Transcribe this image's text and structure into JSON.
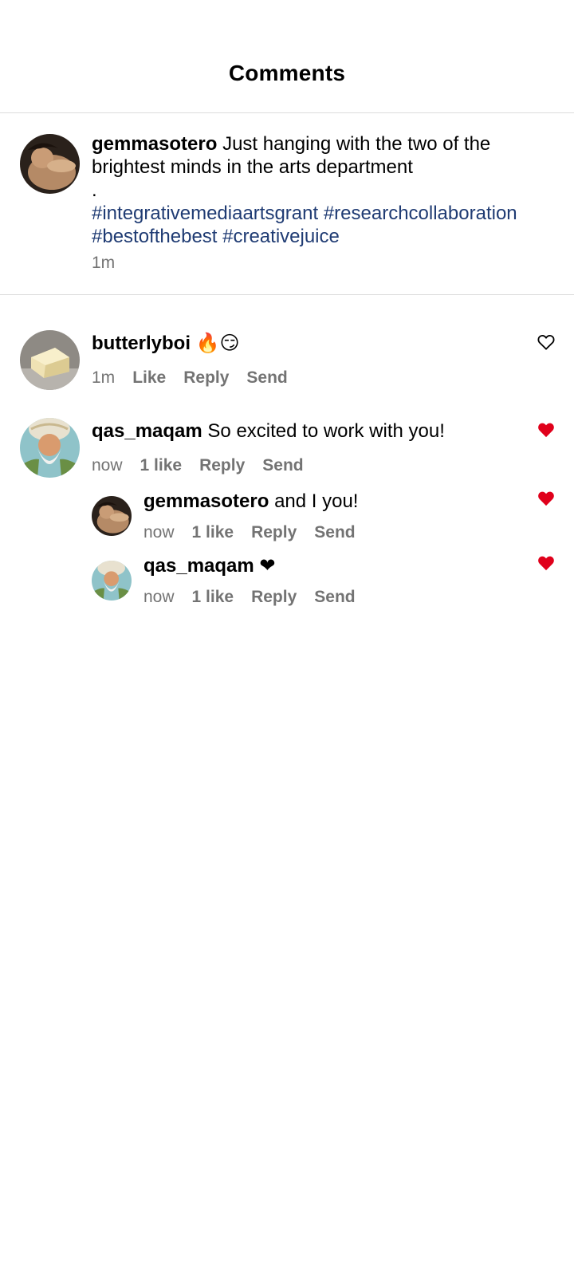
{
  "header": {
    "title": "Comments"
  },
  "caption": {
    "username": "gemmasotero",
    "text": "Just hanging with the two of the brightest minds in the arts department",
    "dot": ".",
    "hashtags": "#integrativemediaartsgrant #researchcollaboration #bestofthebest #creativejuice",
    "time": "1m"
  },
  "comments": [
    {
      "username": "butterlyboi",
      "text": "🔥😏",
      "time": "1m",
      "like_label": "Like",
      "reply_label": "Reply",
      "send_label": "Send",
      "liked": false
    },
    {
      "username": "qas_maqam",
      "text": "So excited to work with you!",
      "time": "now",
      "like_label": "1 like",
      "reply_label": "Reply",
      "send_label": "Send",
      "liked": true
    },
    {
      "username": "gemmasotero",
      "text": "and I you!",
      "time": "now",
      "like_label": "1 like",
      "reply_label": "Reply",
      "send_label": "Send",
      "liked": true
    },
    {
      "username": "qas_maqam",
      "text": "❤",
      "time": "now",
      "like_label": "1 like",
      "reply_label": "Reply",
      "send_label": "Send",
      "liked": true
    }
  ],
  "colors": {
    "liked_heart": "#e0001b",
    "hashtag": "#1f3b73",
    "muted": "#737373",
    "divider": "#dbdbdb"
  }
}
